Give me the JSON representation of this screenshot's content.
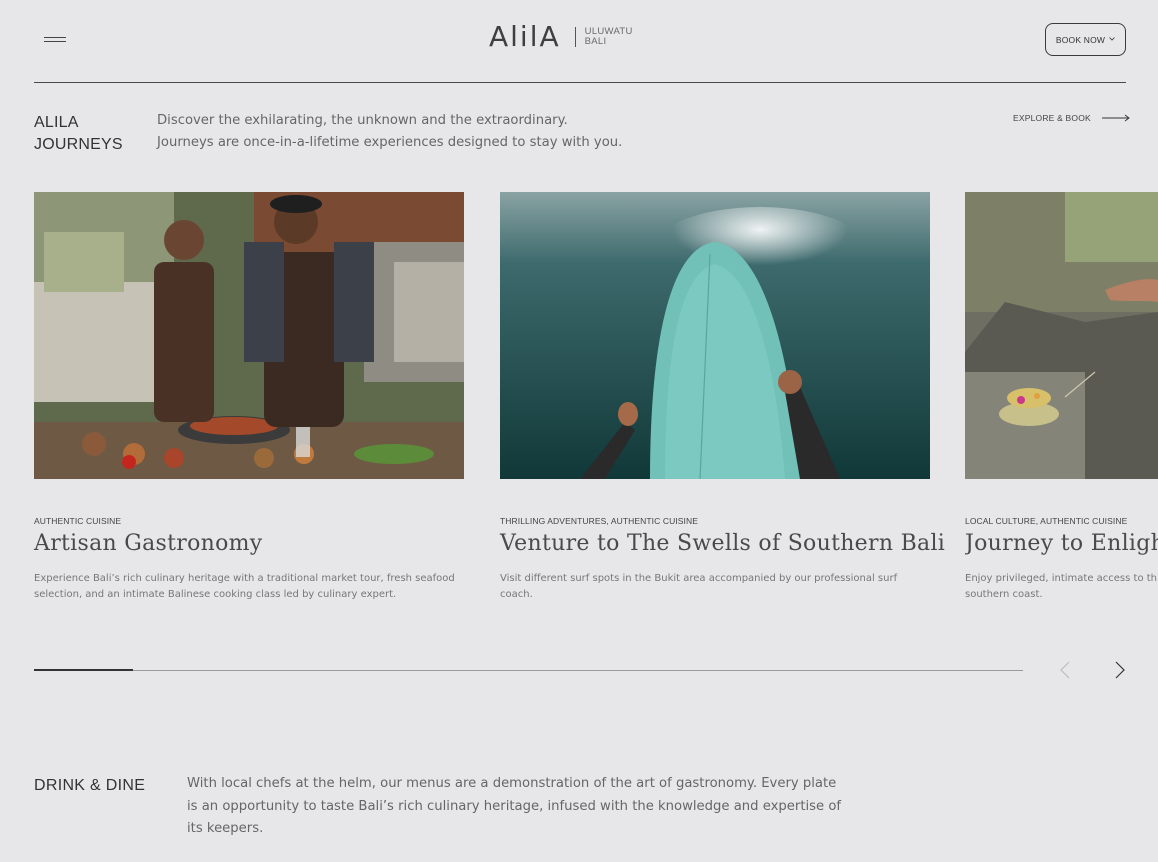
{
  "header": {
    "logo_word": "AlilA",
    "location_line1": "ULUWATU",
    "location_line2": "BALI",
    "book_label": "BOOK NOW"
  },
  "journeys": {
    "title_line1": "ALILA",
    "title_line2": "JOURNEYS",
    "intro_line1": "Discover the exhilarating, the unknown and the extraordinary.",
    "intro_line2": "Journeys are once-in-a-lifetime experiences designed to stay with you.",
    "explore_label": "EXPLORE & BOOK",
    "cards": [
      {
        "tags": "AUTHENTIC CUISINE",
        "title": "Artisan Gastronomy",
        "description": "Experience Bali’s rich culinary heritage with a traditional market tour, fresh seafood selection, and an intimate Balinese cooking class led by culinary expert.",
        "image": "two-chefs-cooking-photo"
      },
      {
        "tags": "THRILLING ADVENTURES, AUTHENTIC CUISINE",
        "title": "Venture to The Swells of Southern Bali",
        "description": "Visit different surf spots in the Bukit area accompanied by our professional surf coach.",
        "image": "surfboard-ocean-photo"
      },
      {
        "tags": "LOCAL CULTURE, AUTHENTIC CUISINE",
        "title": "Journey to Enlighte",
        "description": "Enjoy privileged, intimate access to th on Bali’s southern coast.",
        "image": "temple-offering-photo"
      }
    ],
    "carousel_progress": 0.1
  },
  "drink_dine": {
    "title": "DRINK & DINE",
    "text": "With local chefs at the helm, our menus are a demonstration of the art of gastronomy. Every plate is an opportunity to taste Bali’s rich culinary heritage, infused with the knowledge and expertise of its keepers."
  },
  "colors": {
    "background": "#e7e7e9",
    "text_dark": "#333333",
    "text_muted": "#666666"
  }
}
